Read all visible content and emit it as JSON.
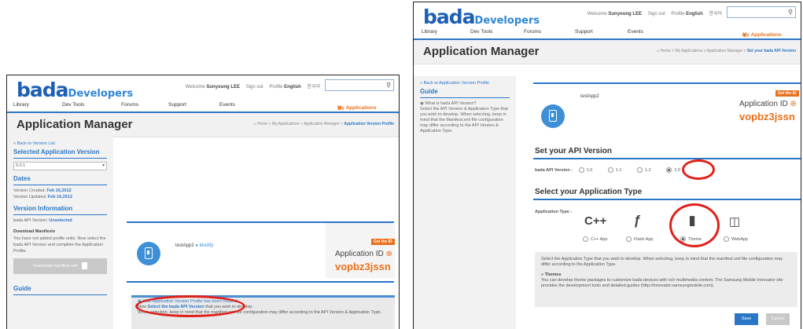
{
  "site": {
    "logo_main": "bada",
    "logo_sub": "Developers",
    "top_welcome": "Welcome",
    "top_user": "Sunyoung LEE",
    "top_signout": "Sign out",
    "top_profile": "Profile",
    "top_english": "English",
    "top_korean": "한국어",
    "search_icon": "search-icon",
    "nav": [
      "Library",
      "Dev Tools",
      "Forums",
      "Support",
      "Events"
    ],
    "nav_myapps": "My Applications",
    "nav_myapps_dot": "⊕",
    "colors": {
      "brand": "#1d5fb5",
      "accent": "#e8711d",
      "highlight": "#e0201a"
    }
  },
  "left": {
    "page_title": "Application Manager",
    "crumb_home": "Home",
    "crumb_path": " > My Applications > Application Manager > ",
    "crumb_current": "Application Version Profile",
    "back_link": "« Back to Version List",
    "selected_version_heading": "Selected Application Version",
    "version_select": "0.0.1",
    "dates_heading": "Dates",
    "created_label": "Version Created: ",
    "created_value": "Feb 16,2012",
    "updated_label": "Version Updated: ",
    "updated_value": "Feb 16,2012",
    "version_info_heading": "Version Information",
    "api_version_text": "bada API Version: ",
    "api_version_value": "Unselected",
    "download_heading": "Download Manifests",
    "download_desc": "You have not added profile units. Now select the bada API Version and complete the Application Profile.",
    "download_button": "Download manifest.xml",
    "guide_heading": "Guide",
    "app_name": "testApp2",
    "modify": "Modify",
    "get_id": "Get the ID",
    "app_id_label": "Application ID",
    "app_id_value": "vopbz3jssn",
    "notice_line1": "Your Application Version Profile has been created.",
    "notice_now": "Now ",
    "notice_link": "Select the bada API Version",
    "notice_after": " that you wish to develop.",
    "notice_line3": "When selection, keep in mind that the manifest.xml file configuration may differ according to the API Version & Application Type."
  },
  "right": {
    "page_title": "Application Manager",
    "crumb_home": "Home",
    "crumb_path": " > My Applications > Application Manager > ",
    "crumb_current": "Set your bada API Version",
    "back_link": "« Back to Application Version Profile",
    "guide_heading": "Guide",
    "guide_q": "What is bada API Version?",
    "guide_text": "Select the API Version & Application Type that you wish to develop. When selecting, keep in mind that the Manifest.xml file configuration may differ according to the API Version & Application Type.",
    "app_name": "testApp2",
    "get_id": "Get the ID",
    "app_id_label": "Application ID",
    "app_id_value": "vopbz3jssn",
    "api_heading": "Set your API Version",
    "api_label": "bada API Version :",
    "api_options": [
      "1.0",
      "1.1",
      "1.2",
      "2.0"
    ],
    "api_selected": "2.0",
    "type_heading": "Select your Application Type",
    "type_label": "Application Type :",
    "types": [
      {
        "label": "C++ App",
        "icon": "cpp-icon",
        "glyph": "C++"
      },
      {
        "label": "Flash App",
        "icon": "flash-icon",
        "glyph": "ƒ"
      },
      {
        "label": "Theme",
        "icon": "theme-brush-icon",
        "glyph": "▮"
      },
      {
        "label": "WebApp",
        "icon": "webapp-icon",
        "glyph": "◫"
      }
    ],
    "type_selected": "Theme",
    "info_text": "Select the Application Type that you wish to develop. When selecting, keep in mind that the manifest.xml file configuration may differ according to the Application Type.",
    "themes_heading": "» Themes",
    "themes_text": "You can develop theme packages to customize bada devices with rich multimedia content. The Samsung Mobile Innovator site provides the development tools and detailed guides (http://innovator.samsungmobile.com).",
    "save": "Save",
    "cancel": "Cancel"
  }
}
